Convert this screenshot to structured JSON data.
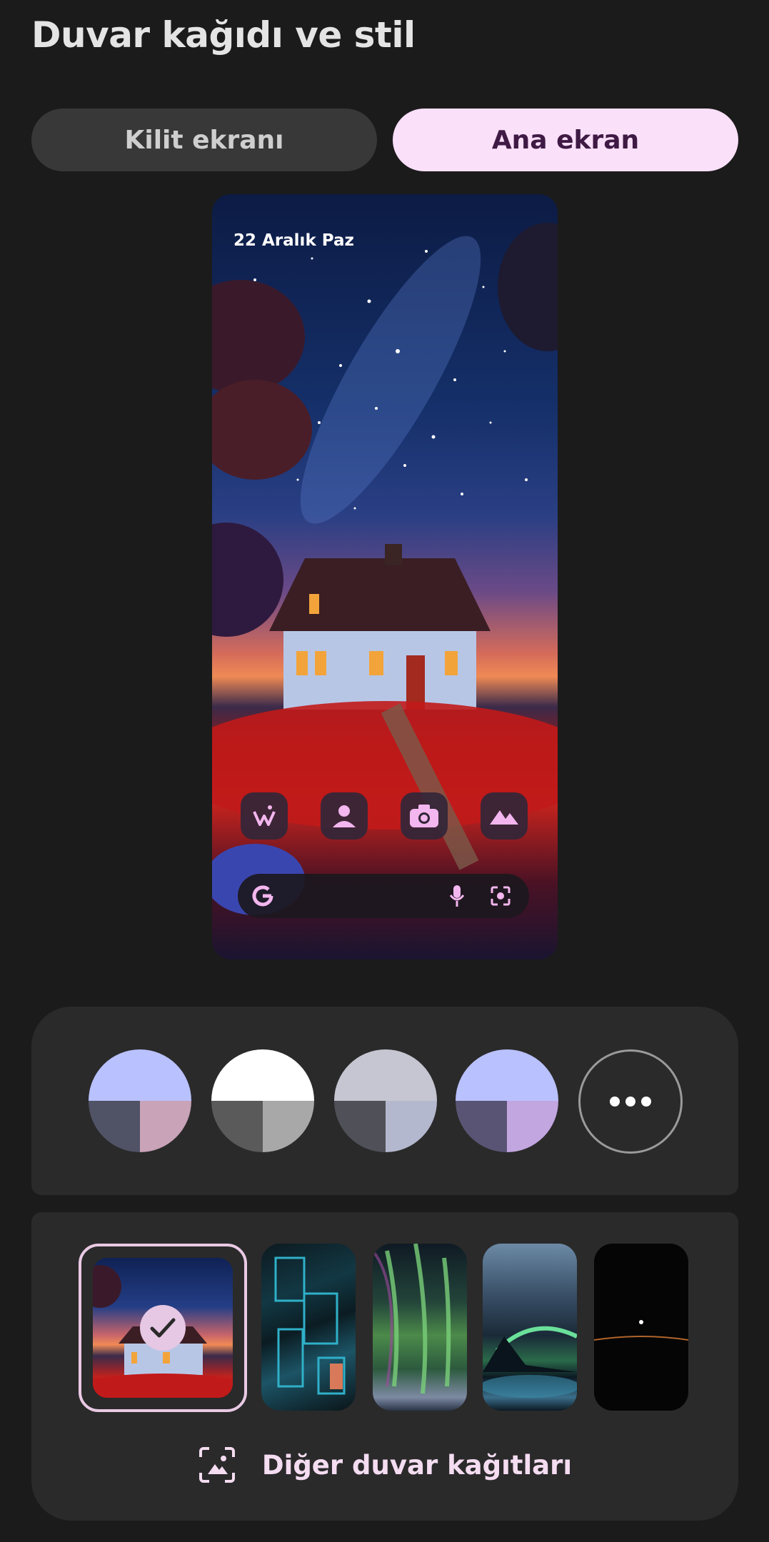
{
  "page": {
    "title": "Duvar kağıdı ve stil"
  },
  "tabs": [
    {
      "label": "Kilit ekranı",
      "selected": false
    },
    {
      "label": "Ana ekran",
      "selected": true
    }
  ],
  "preview": {
    "date": "22 Aralık Paz",
    "apps": [
      {
        "icon": "wallet-sparkle-icon"
      },
      {
        "icon": "contacts-icon"
      },
      {
        "icon": "camera-icon"
      },
      {
        "icon": "gallery-icon"
      }
    ],
    "searchbar": {
      "icons": [
        "google-icon",
        "mic-icon",
        "lens-icon"
      ]
    }
  },
  "palettes": [
    {
      "top": "#b9c1ff",
      "bottom_left": "#505266",
      "bottom_right": "#c9a3b8",
      "selected": true
    },
    {
      "top": "#ffffff",
      "bottom_left": "#5a5a5a",
      "bottom_right": "#a8a8a8",
      "selected": false
    },
    {
      "top": "#c6c6d2",
      "bottom_left": "#505058",
      "bottom_right": "#b4b8ce",
      "selected": false
    },
    {
      "top": "#b9c1ff",
      "bottom_left": "#5a5474",
      "bottom_right": "#c2a6e0",
      "selected": false
    }
  ],
  "palette_more": {
    "icon": "more-dots-icon"
  },
  "wallpapers": [
    {
      "name": "starry-cottage",
      "selected": true
    },
    {
      "name": "teal-blocks",
      "selected": false
    },
    {
      "name": "aurora-curtains",
      "selected": false
    },
    {
      "name": "mountain-aurora",
      "selected": false
    },
    {
      "name": "dark-horizon",
      "selected": false
    }
  ],
  "more_wallpapers": {
    "label": "Diğer duvar kağıtları",
    "icon": "wallpaper-icon"
  },
  "colors": {
    "accent_bg": "#fbe0fa",
    "accent_text": "#3e1a44",
    "panel_bg": "#2a2a2a",
    "page_bg": "#1b1b1b"
  }
}
